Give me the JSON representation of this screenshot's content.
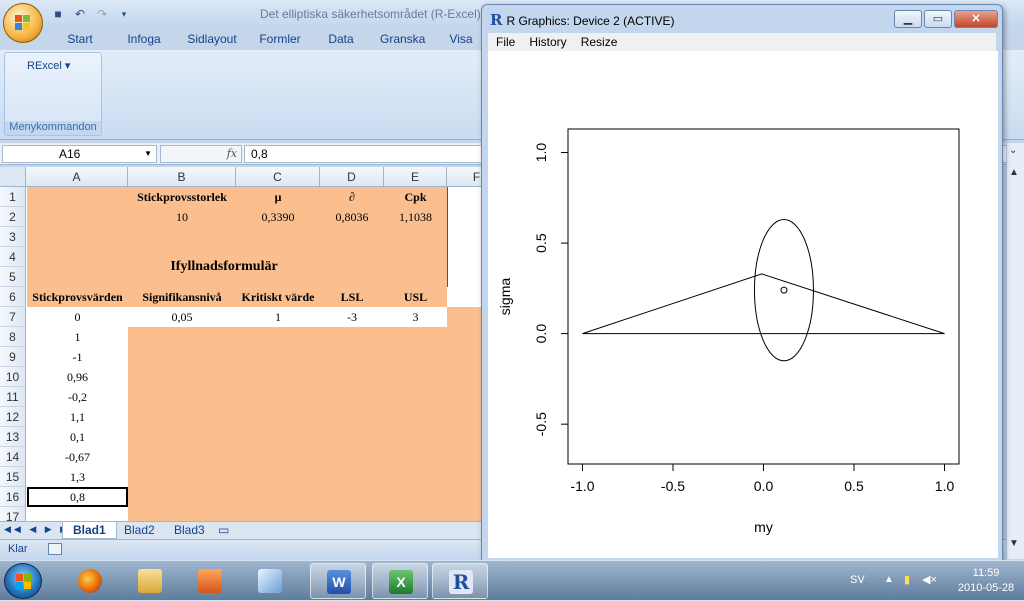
{
  "excel": {
    "title": "Det elliptiska säkerhetsområdet (R-Excel)",
    "tabs": [
      "Start",
      "Infoga",
      "Sidlayout",
      "Formler",
      "Data",
      "Granska",
      "Visa"
    ],
    "ribbon_group": {
      "button": "RExcel ▾",
      "label": "Menykommandon"
    },
    "name_box": "A16",
    "formula": "0,8",
    "columns": [
      "A",
      "B",
      "C",
      "D",
      "E",
      "F"
    ],
    "rows": [
      "1",
      "2",
      "3",
      "4",
      "5",
      "6",
      "7",
      "8",
      "9",
      "10",
      "11",
      "12",
      "13",
      "14",
      "15",
      "16",
      "17"
    ],
    "header_row1": [
      "Stickprovsstorlek",
      "μ",
      "∂",
      "Cpk"
    ],
    "values_row2": [
      "10",
      "0,3390",
      "0,8036",
      "1,1038"
    ],
    "form_title": "Ifyllnadsformulär",
    "header_row6": [
      "Stickprovsvärden",
      "Signifikansnivå",
      "Kritiskt värde",
      "LSL",
      "USL"
    ],
    "values_row7": [
      "0,05",
      "1",
      "-3",
      "3"
    ],
    "samples": [
      "0",
      "1",
      "-1",
      "0,96",
      "-0,2",
      "1,1",
      "0,1",
      "-0,67",
      "1,3",
      "0,8"
    ],
    "sheet_tabs": [
      "Blad1",
      "Blad2",
      "Blad3"
    ],
    "status": "Klar"
  },
  "rgraphics": {
    "title": "R Graphics: Device 2 (ACTIVE)",
    "menu": [
      "File",
      "History",
      "Resize"
    ]
  },
  "chart_data": {
    "type": "scatter",
    "xlabel": "my",
    "ylabel": "sigma",
    "xlim": [
      -1.08,
      1.08
    ],
    "ylim": [
      -0.72,
      1.13
    ],
    "xticks": [
      -1.0,
      -0.5,
      0.0,
      0.5,
      1.0
    ],
    "yticks": [
      -0.5,
      0.0,
      0.5,
      1.0
    ],
    "xtick_labels": [
      "-1.0",
      "-0.5",
      "0.0",
      "0.5",
      "1.0"
    ],
    "ytick_labels": [
      "-0.5",
      "0.0",
      "0.5",
      "1.0"
    ],
    "triangle": [
      [
        -1.0,
        0.0
      ],
      [
        -0.01,
        0.33
      ],
      [
        1.0,
        0.0
      ],
      [
        -1.0,
        0.0
      ]
    ],
    "point": [
      0.113,
      0.24
    ],
    "ellipse": {
      "center": [
        0.113,
        0.24
      ],
      "rx": 0.163,
      "ry": 0.39
    }
  },
  "taskbar": {
    "language": "SV",
    "time": "11:59",
    "date": "2010-05-28"
  }
}
